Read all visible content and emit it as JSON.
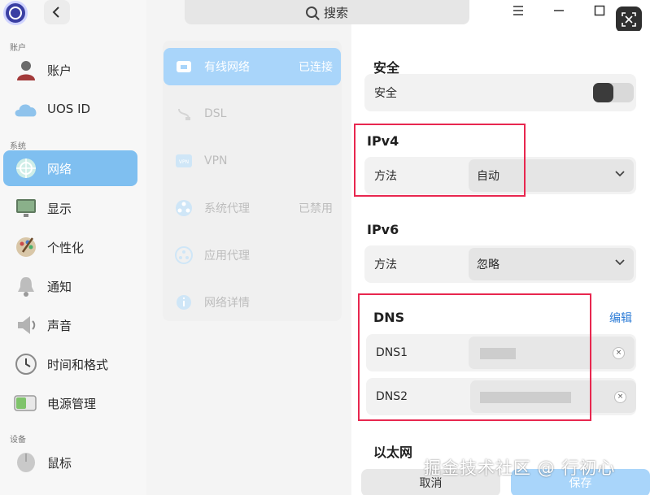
{
  "colors": {
    "accent": "#7fbff0",
    "accent_light": "#a9d5fa",
    "highlight_box": "#e8274f",
    "link": "#2b7bd6"
  },
  "titlebar": {
    "search_label": "搜索",
    "search_icon": "search-icon",
    "back_icon": "chevron-left-icon",
    "menu_icon": "hamburger-icon",
    "minimize_icon": "minimize-icon",
    "maximize_icon": "maximize-icon",
    "screenshot_icon": "screenshot-icon"
  },
  "sidebar": {
    "sections": [
      {
        "label": "账户",
        "items": [
          {
            "label": "账户",
            "icon": "account-avatar-icon"
          },
          {
            "label": "UOS ID",
            "icon": "cloud-icon"
          }
        ]
      },
      {
        "label": "系统",
        "items": [
          {
            "label": "网络",
            "icon": "network-globe-icon",
            "active": true
          },
          {
            "label": "显示",
            "icon": "display-monitor-icon"
          },
          {
            "label": "个性化",
            "icon": "personalization-palette-icon"
          },
          {
            "label": "通知",
            "icon": "notification-bell-icon"
          },
          {
            "label": "声音",
            "icon": "sound-speaker-icon"
          },
          {
            "label": "时间和格式",
            "icon": "clock-icon"
          },
          {
            "label": "电源管理",
            "icon": "battery-icon"
          }
        ]
      },
      {
        "label": "设备",
        "items": [
          {
            "label": "鼠标",
            "icon": "mouse-icon"
          }
        ]
      }
    ]
  },
  "network_menu": {
    "items": [
      {
        "label": "有线网络",
        "status": "已连接",
        "icon": "wired-network-icon",
        "active": true
      },
      {
        "label": "DSL",
        "status": "",
        "icon": "dsl-icon"
      },
      {
        "label": "VPN",
        "status": "",
        "icon": "vpn-icon"
      },
      {
        "label": "系统代理",
        "status": "已禁用",
        "icon": "system-proxy-icon"
      },
      {
        "label": "应用代理",
        "status": "",
        "icon": "app-proxy-icon"
      },
      {
        "label": "网络详情",
        "status": "",
        "icon": "info-icon"
      }
    ]
  },
  "settings": {
    "security": {
      "heading": "安全",
      "label": "安全",
      "toggle_on": false
    },
    "ipv4": {
      "heading": "IPv4",
      "method_label": "方法",
      "method_value": "自动"
    },
    "ipv6": {
      "heading": "IPv6",
      "method_label": "方法",
      "method_value": "忽略"
    },
    "dns": {
      "heading": "DNS",
      "edit_label": "编辑",
      "dns1_label": "DNS1",
      "dns2_label": "DNS2",
      "clear_glyph": "×"
    },
    "ethernet": {
      "heading": "以太网"
    }
  },
  "footer": {
    "cancel_label": "取消",
    "save_label": "保存",
    "watermark": "掘金技术社区 @ 行初心"
  }
}
